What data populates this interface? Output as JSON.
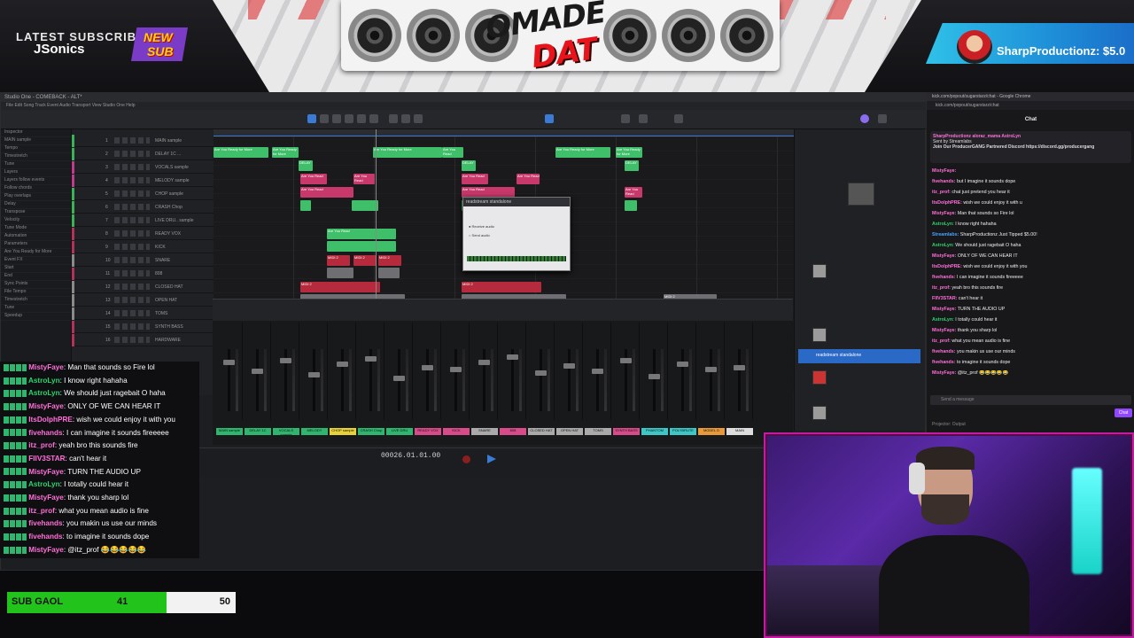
{
  "overlay": {
    "latest_subscriber_label": "LATEST SUBSCRIBER",
    "latest_subscriber_name": "JSonics",
    "new_sub_badge_line1": "NEW",
    "new_sub_badge_line2": "SUB",
    "logo_line1": "OMADE",
    "logo_line2": "DAT",
    "tip_text": "SharpProductionz: $5.0",
    "sub_goal": {
      "label": "SUB GAOL",
      "current": "41",
      "target": "50",
      "progress": 0.82
    }
  },
  "daw": {
    "window_title": "Studio One - COMEBACK - ALT*",
    "menu": "File   Edit   Song   Track   Event   Audio   Transport   View   Studio One   Help",
    "timecode": "00026.01.01.00",
    "tracks": [
      {
        "num": "1",
        "name": "MAIN sample",
        "color": "#38b35a"
      },
      {
        "num": "2",
        "name": "DELAY 1C ...",
        "color": "#38b35a"
      },
      {
        "num": "3",
        "name": "VOCALS sample",
        "color": "#c23a8e"
      },
      {
        "num": "4",
        "name": "MELODY sample",
        "color": "#c23a8e"
      },
      {
        "num": "5",
        "name": "CHOP sample",
        "color": "#38b35a"
      },
      {
        "num": "6",
        "name": "CRASH Chop",
        "color": "#38b35a"
      },
      {
        "num": "7",
        "name": "LIVE DRU.. sample",
        "color": "#38b35a"
      },
      {
        "num": "8",
        "name": "READY VOX",
        "color": "#b3315a"
      },
      {
        "num": "9",
        "name": "KICK",
        "color": "#b3315a"
      },
      {
        "num": "10",
        "name": "SNARE",
        "color": "#8a8a8a"
      },
      {
        "num": "11",
        "name": "808",
        "color": "#b3315a"
      },
      {
        "num": "12",
        "name": "CLOSED HAT",
        "color": "#8a8a8a"
      },
      {
        "num": "13",
        "name": "OPEN HAT",
        "color": "#8a8a8a"
      },
      {
        "num": "14",
        "name": "TOMS",
        "color": "#8a8a8a"
      },
      {
        "num": "15",
        "name": "SYNTH BASS",
        "color": "#b3315a"
      },
      {
        "num": "16",
        "name": "HARDWARE",
        "color": "#b3315a"
      }
    ],
    "inspector_rows": [
      "Inspector",
      "MAIN sample",
      "Tempo",
      "Timestretch",
      "Tune",
      "Layers",
      "Layers follow events",
      "Follow chords",
      "Play overlaps",
      "Delay",
      "Transpose",
      "Velocity",
      "Tune Mode",
      "Automation",
      "Parameters",
      "Are You Ready for More",
      "Event FX",
      "Start",
      "End",
      "Sync Points",
      "File Tempo",
      "Timestretch",
      "Tune",
      "Speedup"
    ],
    "clip_labels": {
      "intro": "Are You Ready for More",
      "midi": "MIDI 2",
      "delay": "DELAY",
      "wait": "Are You Read"
    },
    "mixer_labels": [
      "MAIN sample",
      "DELAY 1C",
      "VOCALS sample",
      "MELODY",
      "CHOP sample",
      "CRASH Chop",
      "LIVE DRU",
      "READY VOX",
      "KICK",
      "SNARE",
      "808",
      "CLOSED HAT",
      "OPEN HAT",
      "TOMS",
      "SYNTH BASS",
      "PHANTOM",
      "POLYBRUTE",
      "MODEL D",
      "MAIN"
    ],
    "browser_highlight": "readstream standalone",
    "plugin_title": "readstream standalone"
  },
  "chat_left": [
    {
      "user": "MistyFaye",
      "msg": ": Man that sounds so Fire lol",
      "cls": "u-pink"
    },
    {
      "user": "AstroLyn",
      "msg": ": I know right hahaha",
      "cls": "u-green"
    },
    {
      "user": "AstroLyn",
      "msg": ": We should just ragebait O haha",
      "cls": "u-green"
    },
    {
      "user": "MistyFaye",
      "msg": ": ONLY OF WE CAN HEAR IT",
      "cls": "u-pink"
    },
    {
      "user": "ItsDolphPRE",
      "msg": ": wish we could enjoy it with you",
      "cls": "u-pink"
    },
    {
      "user": "fivehands",
      "msg": ": I can imagine it sounds fireeeee",
      "cls": "u-pink"
    },
    {
      "user": "itz_prof",
      "msg": ": yeah bro this sounds fire",
      "cls": "u-pink"
    },
    {
      "user": "FIIV3STAR",
      "msg": ": can't hear it",
      "cls": "u-pink"
    },
    {
      "user": "MistyFaye",
      "msg": ": TURN THE AUDIO UP",
      "cls": "u-pink"
    },
    {
      "user": "AstroLyn",
      "msg": ": I totally could hear it",
      "cls": "u-green"
    },
    {
      "user": "MistyFaye",
      "msg": ": thank you sharp lol",
      "cls": "u-pink"
    },
    {
      "user": "itz_prof",
      "msg": ": what you mean audio is fine",
      "cls": "u-pink"
    },
    {
      "user": "fivehands",
      "msg": ": you makin us use our minds",
      "cls": "u-pink"
    },
    {
      "user": "fivehands",
      "msg": ": to imagine it sounds dope",
      "cls": "u-pink"
    },
    {
      "user": "MistyFaye",
      "msg": ": @itz_prof 😂😂😂😂😂",
      "cls": "u-pink"
    }
  ],
  "chat_right": {
    "tab": "kick.com/popout/sugarstarz/chat - Google Chrome",
    "url": "kick.com/popout/sugarstarz/chat",
    "header": "Chat",
    "pinned_users": "SharpProductionz   aloraz_mama   AstroLyn",
    "pinned_msg": "Join Our ProducerGANG Partnered Discord https://discord.gg/producergang",
    "pinned_by": "Sent by Streamlabs",
    "lines": [
      "MistyFaye: ",
      "fivehands: but I imagine it sounds dope",
      "itz_prof: chat just pretend you hear it",
      "ItsDolphPRE: wish we could enjoy it with u",
      "MistyFaye: Man that sounds so Fire lol",
      "AstroLyn: I know right hahaha",
      "Streamlabs: SharpProductionz Just Tipped $5.00!",
      "AstroLyn: We should just ragebait O haha",
      "MistyFaye: ONLY OF WE CAN HEAR IT",
      "ItsDolphPRE: wish we could enjoy it with you",
      "fivehands: I can imagine it sounds fireeeee",
      "itz_prof: yeah bro this sounds fire",
      "FIIV3STAR: can't hear it",
      "MistyFaye: TURN THE AUDIO UP",
      "AstroLyn: I totally could hear it",
      "MistyFaye: thank you sharp lol",
      "itz_prof: what you mean audio is fine",
      "fivehands: you makin us use our minds",
      "fivehands: to imagine it sounds dope",
      "MistyFaye: @itz_prof 😂😂😂😂😂"
    ],
    "input_placeholder": "Send a message",
    "chat_button": "Chat",
    "projector": "Projector: Output"
  }
}
